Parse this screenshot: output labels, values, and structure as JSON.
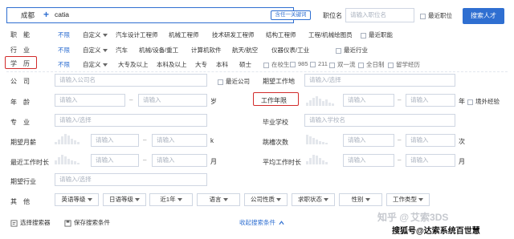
{
  "search": {
    "city": "成都",
    "plus": "+",
    "query": "catia",
    "keyword_mode": "含任一关键词",
    "position_label": "职位名",
    "position_placeholder": "请输入职位名",
    "recent_position": "最近职位",
    "search_button": "搜索人才"
  },
  "function": {
    "label": "职　能",
    "unlimited": "不限",
    "custom": "自定义",
    "options": [
      "汽车设计工程师",
      "机械工程师",
      "技术研发工程师",
      "结构工程师",
      "工程/机械绘图员"
    ],
    "recent": "最近职能"
  },
  "industry": {
    "label": "行　业",
    "unlimited": "不限",
    "custom": "自定义",
    "options": [
      "汽车",
      "机械/设备/重工",
      "计算机软件",
      "航天/航空",
      "仪器仪表/工业"
    ],
    "recent": "最近行业"
  },
  "education": {
    "label": "学　历",
    "unlimited": "不限",
    "custom": "自定义",
    "options": [
      "大专及以上",
      "本科及以上",
      "大专",
      "本科",
      "硕士"
    ],
    "checks": [
      "在校生",
      "985",
      "211",
      "双一流",
      "全日制",
      "留学经历"
    ]
  },
  "company": {
    "label": "公　司",
    "placeholder": "请输入公司名",
    "recent": "最近公司"
  },
  "expected_location": {
    "label": "期望工作地",
    "placeholder": "请输入/选择"
  },
  "age": {
    "label": "年　龄",
    "from": "请输入",
    "to": "请输入",
    "unit": "岁"
  },
  "work_years": {
    "label": "工作年限",
    "from": "请输入",
    "to": "请输入",
    "unit": "年",
    "overseas": "境外经验"
  },
  "major": {
    "label": "专　业",
    "placeholder": "请输入/选择"
  },
  "school": {
    "label": "毕业学校",
    "placeholder": "请输入学校名"
  },
  "expected_salary": {
    "label": "期望月薪",
    "from": "请输入",
    "to": "请输入",
    "unit": "k"
  },
  "job_hops": {
    "label": "跳槽次数",
    "from": "请输入",
    "to": "请输入",
    "unit": "次"
  },
  "recent_duration": {
    "label": "最近工作时长",
    "from": "请输入",
    "to": "请输入",
    "unit": "月"
  },
  "avg_duration": {
    "label": "平均工作时长",
    "from": "请输入",
    "to": "请输入",
    "unit": "月"
  },
  "expected_industry": {
    "label": "期望行业",
    "placeholder": "请输入/选择"
  },
  "other": {
    "label": "其　他",
    "selects": [
      "英语等级",
      "日语等级",
      "近1年",
      "语言",
      "公司性质",
      "求职状态",
      "性别",
      "工作类型"
    ]
  },
  "footer": {
    "choose": "选择搜索器",
    "save": "保存搜索条件",
    "collapse": "收起搜索条件"
  },
  "watermark": {
    "text1": "知乎 @",
    "text2": "搜狐号@",
    "text3": "艾索3DS",
    "text4": "达索系统百世慧"
  },
  "colors": {
    "accent": "#2f6fd1",
    "highlight": "#d22b2b"
  }
}
